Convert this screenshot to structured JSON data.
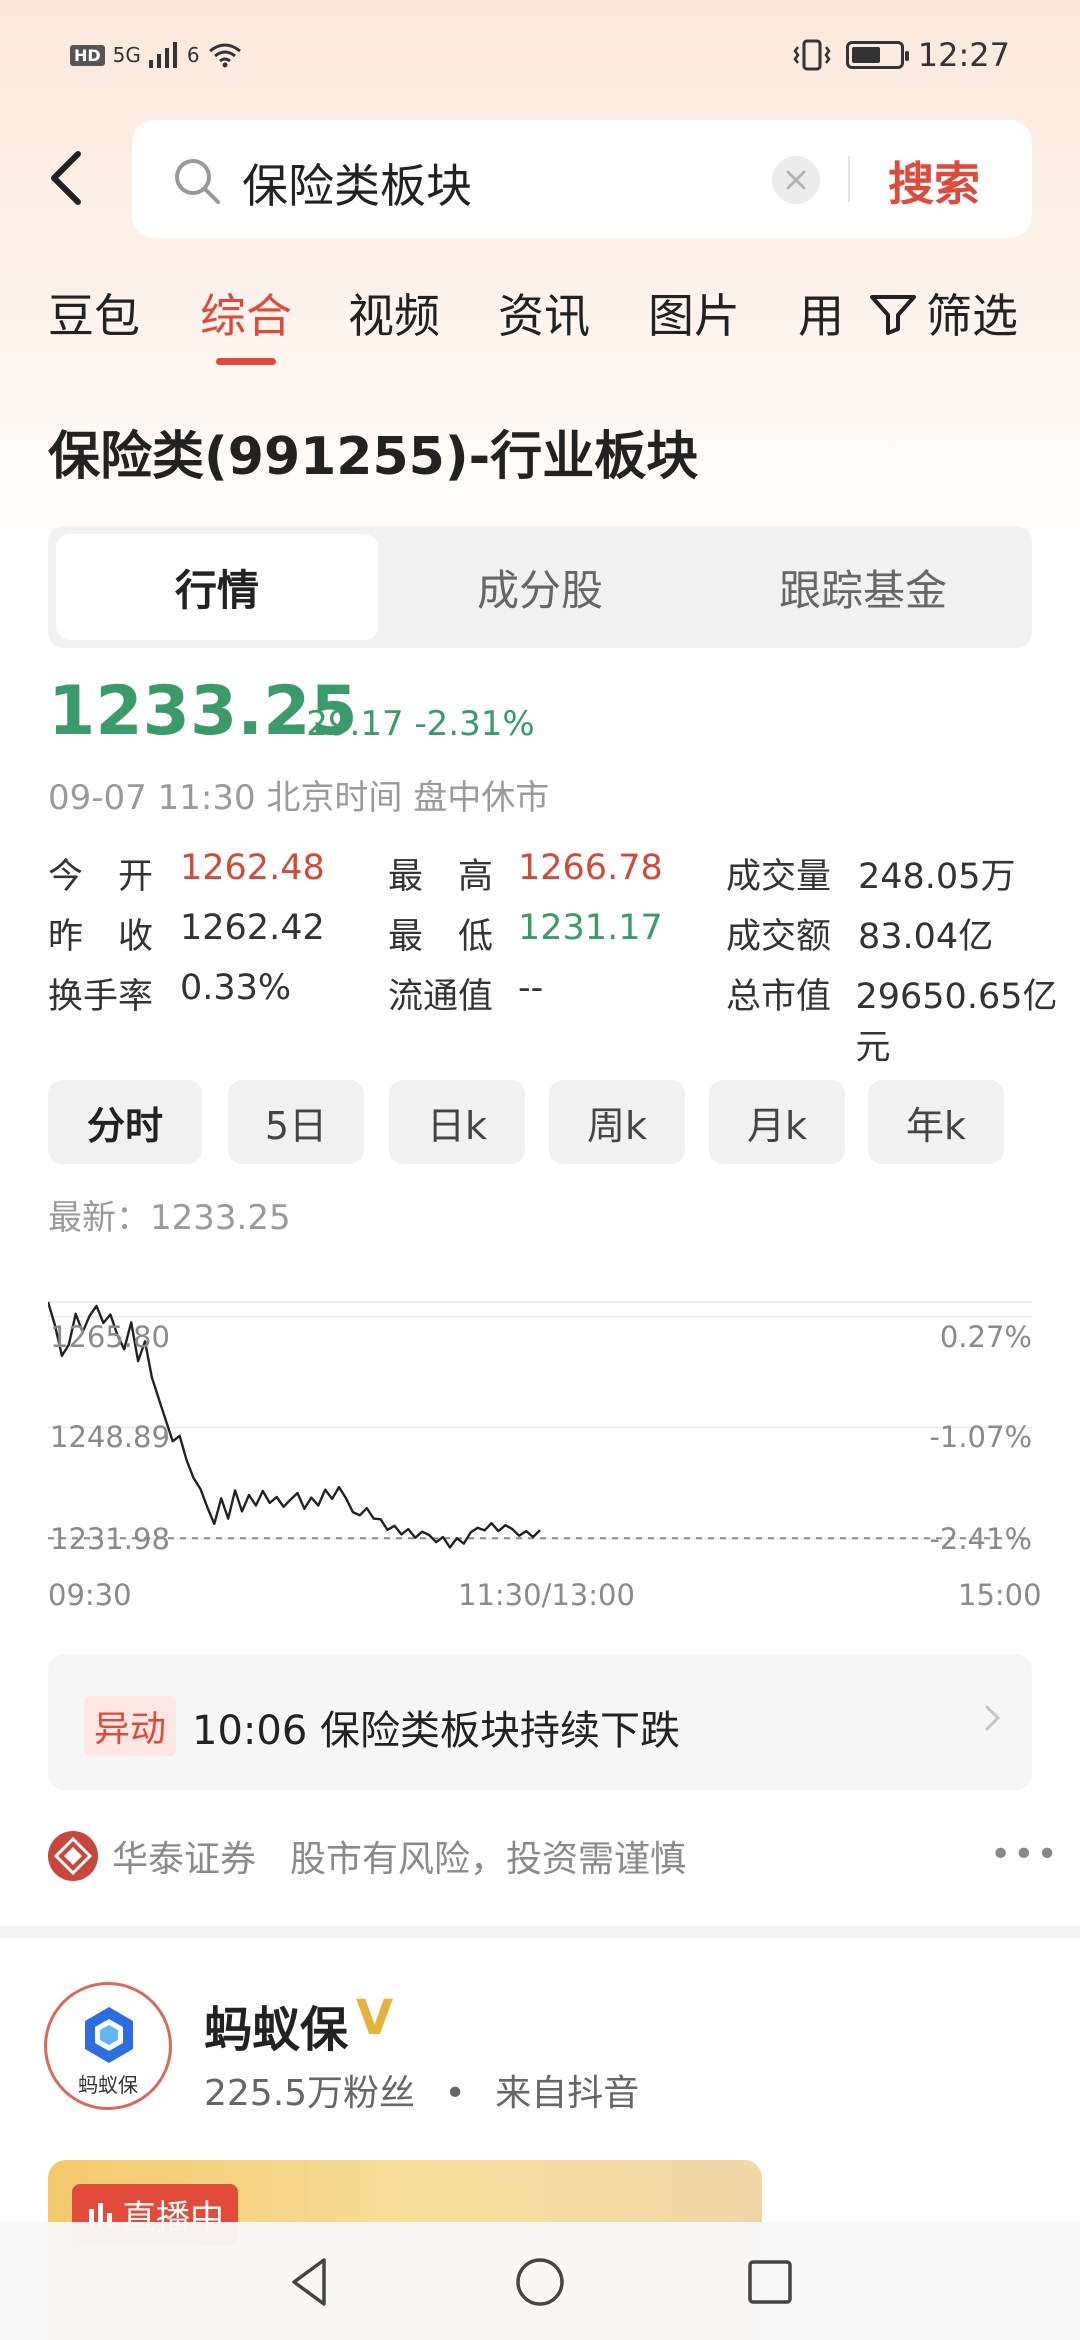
{
  "status_bar": {
    "hd": "HD",
    "signal1": "5G",
    "signal2": "6",
    "time": "12:27",
    "battery_level": 0.62
  },
  "search": {
    "query": "保险类板块",
    "button": "搜索"
  },
  "tabs": [
    {
      "label": "豆包",
      "active": false
    },
    {
      "label": "综合",
      "active": true
    },
    {
      "label": "视频",
      "active": false
    },
    {
      "label": "资讯",
      "active": false
    },
    {
      "label": "图片",
      "active": false
    },
    {
      "label": "用",
      "active": false
    }
  ],
  "filter_label": "筛选",
  "title": "保险类(991255)-行业板块",
  "segments": [
    {
      "label": "行情",
      "active": true
    },
    {
      "label": "成分股",
      "active": false
    },
    {
      "label": "跟踪基金",
      "active": false
    }
  ],
  "quote": {
    "price": "1233.25",
    "change": "-29.17 -2.31%",
    "time_note": "09-07 11:30 北京时间 盘中休市"
  },
  "stats": [
    [
      {
        "label": "今　开",
        "value": "1262.48",
        "color": "red"
      },
      {
        "label": "最　高",
        "value": "1266.78",
        "color": "red"
      },
      {
        "label": "成交量",
        "value": "248.05万",
        "color": ""
      }
    ],
    [
      {
        "label": "昨　收",
        "value": "1262.42",
        "color": ""
      },
      {
        "label": "最　低",
        "value": "1231.17",
        "color": "green"
      },
      {
        "label": "成交额",
        "value": "83.04亿",
        "color": ""
      }
    ],
    [
      {
        "label": "换手率",
        "value": "0.33%",
        "color": ""
      },
      {
        "label": "流通值",
        "value": "--",
        "color": ""
      },
      {
        "label": "总市值",
        "value": "29650.65亿元",
        "color": ""
      }
    ]
  ],
  "periods": [
    {
      "label": "分时",
      "active": true
    },
    {
      "label": "5日",
      "active": false
    },
    {
      "label": "日k",
      "active": false
    },
    {
      "label": "周k",
      "active": false
    },
    {
      "label": "月k",
      "active": false
    },
    {
      "label": "年k",
      "active": false
    }
  ],
  "latest": "最新：1233.25",
  "chart_data": {
    "type": "line",
    "y_ticks": [
      "1265.80",
      "1248.89",
      "1231.98"
    ],
    "y_ticks_right": [
      "0.27%",
      "-1.07%",
      "-2.41%"
    ],
    "x_ticks": [
      "09:30",
      "11:30/13:00",
      "15:00"
    ],
    "baseline": 1262.42,
    "ylim": [
      1229.0,
      1268.0
    ],
    "series": [
      {
        "values": [
          1268.0,
          1264.5,
          1259.8,
          1261.5,
          1266.2,
          1263.4,
          1265.9,
          1267.4,
          1264.8,
          1266.1,
          1263.0,
          1260.8,
          1264.9,
          1259.0,
          1262.0,
          1256.5,
          1253.2,
          1250.0,
          1246.8,
          1247.6,
          1243.9,
          1241.2,
          1239.5,
          1236.7,
          1234.2,
          1238.1,
          1235.0,
          1239.3,
          1236.1,
          1238.6,
          1237.0,
          1239.2,
          1237.4,
          1238.3,
          1236.8,
          1237.9,
          1238.9,
          1236.5,
          1238.2,
          1237.0,
          1239.4,
          1238.0,
          1239.8,
          1238.1,
          1236.0,
          1235.5,
          1236.6,
          1235.0,
          1234.9,
          1233.3,
          1233.9,
          1232.6,
          1233.4,
          1232.1,
          1233.0,
          1232.5,
          1231.4,
          1232.2,
          1230.6,
          1232.0,
          1231.2,
          1232.9,
          1233.6,
          1233.2,
          1234.3,
          1233.1,
          1234.0,
          1233.4,
          1232.4,
          1233.1,
          1232.2,
          1233.25
        ]
      }
    ]
  },
  "alert": {
    "tag": "异动",
    "text": "10:06 保险类板块持续下跌"
  },
  "source": {
    "name": "华泰证券",
    "note": "股市有风险，投资需谨慎"
  },
  "account": {
    "name": "蚂蚁保",
    "verified": "V",
    "avatar_label": "蚂蚁保",
    "followers": "225.5万粉丝",
    "origin": "来自抖音"
  },
  "live": {
    "label": "直播中"
  }
}
